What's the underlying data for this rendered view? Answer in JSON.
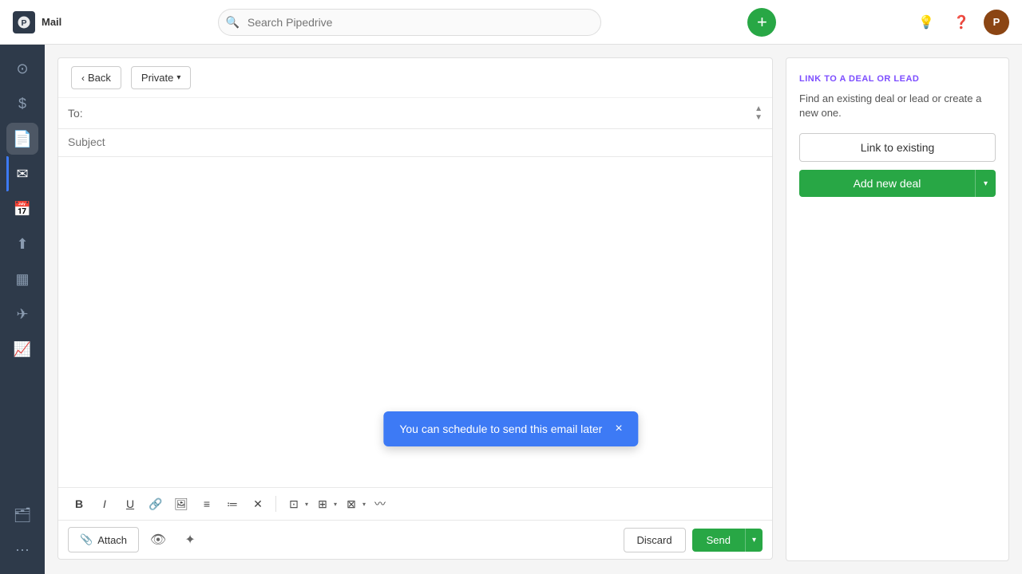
{
  "topnav": {
    "title": "Mail",
    "search_placeholder": "Search Pipedrive",
    "add_btn_label": "+",
    "avatar_initials": "P"
  },
  "sidebar": {
    "items": [
      {
        "id": "home",
        "icon": "⊙",
        "active": false
      },
      {
        "id": "deals",
        "icon": "$",
        "active": false
      },
      {
        "id": "email",
        "icon": "✉",
        "active": true
      },
      {
        "id": "calendar",
        "icon": "☐",
        "active": false
      },
      {
        "id": "import",
        "icon": "⬆",
        "active": false
      },
      {
        "id": "reports",
        "icon": "▦",
        "active": false
      },
      {
        "id": "activity",
        "icon": "↗",
        "active": false
      },
      {
        "id": "more",
        "icon": "⋯",
        "active": false
      }
    ]
  },
  "composer": {
    "back_label": "Back",
    "private_label": "Private",
    "to_label": "To:",
    "to_placeholder": "",
    "subject_placeholder": "Subject",
    "format_buttons": [
      "B",
      "I",
      "U",
      "🔗",
      "🖼",
      "≡",
      "≔",
      "✕"
    ],
    "attach_label": "Attach",
    "discard_label": "Discard",
    "send_label": "Send"
  },
  "right_panel": {
    "section_label": "LINK TO A DEAL OR LEAD",
    "description": "Find an existing deal or lead or create a new one.",
    "link_existing_label": "Link to existing",
    "add_deal_label": "Add new deal"
  },
  "toast": {
    "message": "You can schedule to send this email later",
    "close_label": "×"
  }
}
